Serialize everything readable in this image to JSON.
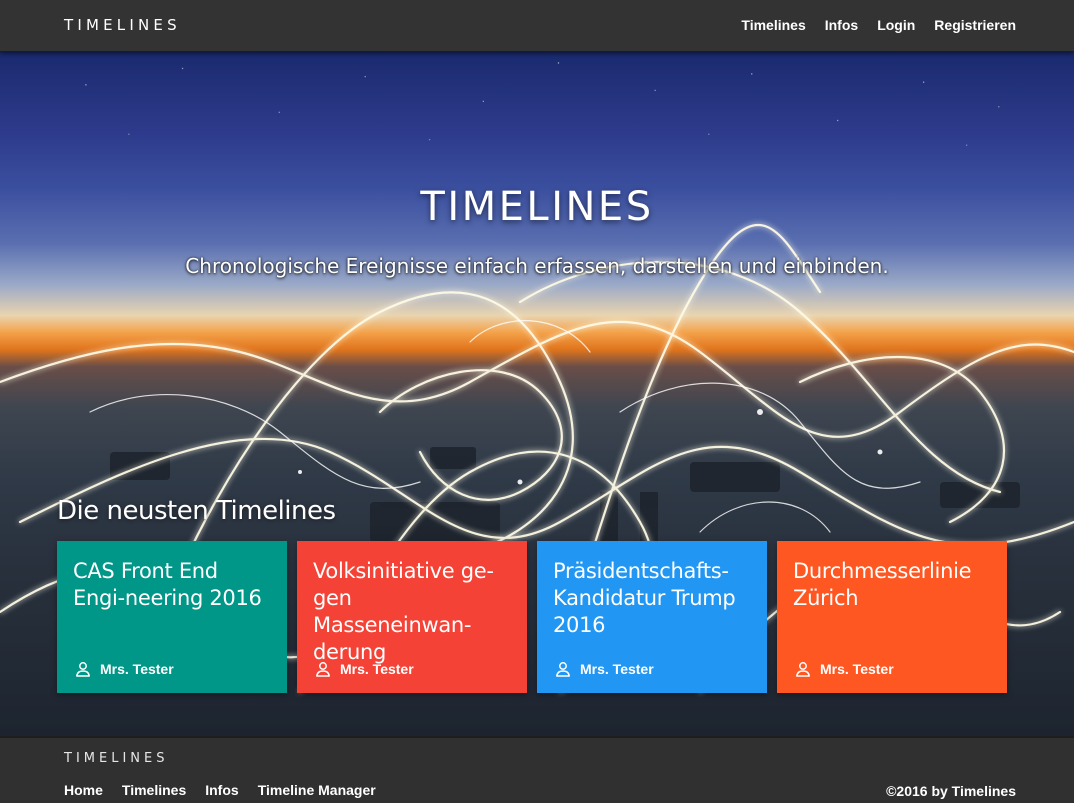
{
  "navbar": {
    "brand": "TIMELINES",
    "links": [
      "Timelines",
      "Infos",
      "Login",
      "Registrieren"
    ]
  },
  "hero": {
    "title": "TIMELINES",
    "subtitle": "Chronologische Ereignisse einfach erfassen, darstellen und einbinden."
  },
  "latest": {
    "heading": "Die neusten Timelines",
    "cards": [
      {
        "title": "CAS Front End Engi-neering 2016",
        "author": "Mrs. Tester",
        "color": "#009688",
        "icon": "user-icon"
      },
      {
        "title": "Volksinitiative ge-gen Masseneinwan-derung",
        "author": "Mrs. Tester",
        "color": "#f44336",
        "icon": "user-icon"
      },
      {
        "title": "Präsidentschafts-Kandidatur Trump 2016",
        "author": "Mrs. Tester",
        "color": "#2196f3",
        "icon": "user-icon"
      },
      {
        "title": "Durchmesserlinie Zürich",
        "author": "Mrs. Tester",
        "color": "#ff5722",
        "icon": "user-icon"
      }
    ]
  },
  "footer": {
    "brand": "TIMELINES",
    "links": [
      "Home",
      "Timelines",
      "Infos",
      "Timeline Manager"
    ],
    "copyright": "©2016 by Timelines"
  }
}
